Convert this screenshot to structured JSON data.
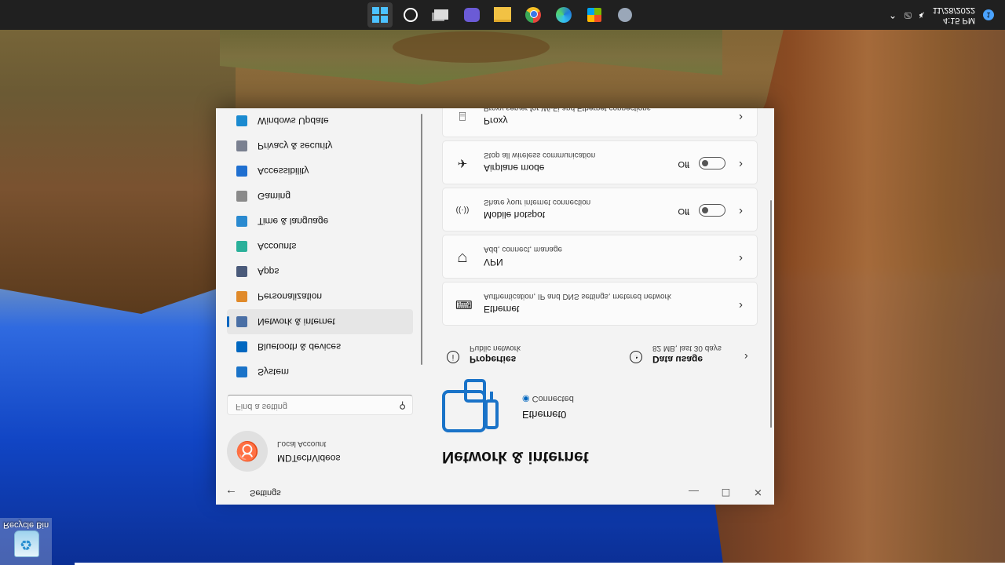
{
  "desktop": {
    "recycle_bin_label": "Recycle Bin"
  },
  "taskbar": {
    "icons": [
      "start-icon",
      "search-icon",
      "task-view-icon",
      "meet-icon",
      "file-explorer-icon",
      "chrome-icon",
      "edge-icon",
      "store-icon",
      "settings-icon"
    ],
    "clock_time": "4:15 PM",
    "clock_date": "11/28/2022",
    "notification_count": "1"
  },
  "window": {
    "title": "Settings",
    "user": {
      "name": "MDTechVideos",
      "account_type": "Local Account"
    },
    "search": {
      "placeholder": "Find a setting"
    },
    "nav": [
      {
        "label": "System",
        "icon": "system-icon",
        "color": "#1a73c8"
      },
      {
        "label": "Bluetooth & devices",
        "icon": "bluetooth-icon",
        "color": "#0067c0"
      },
      {
        "label": "Network & internet",
        "icon": "network-icon",
        "color": "#4a6fa5",
        "selected": true
      },
      {
        "label": "Personalization",
        "icon": "brush-icon",
        "color": "#e08a2a"
      },
      {
        "label": "Apps",
        "icon": "apps-icon",
        "color": "#4a5a7a"
      },
      {
        "label": "Accounts",
        "icon": "accounts-icon",
        "color": "#2ab09a"
      },
      {
        "label": "Time & language",
        "icon": "globe-clock-icon",
        "color": "#2a8ad0"
      },
      {
        "label": "Gaming",
        "icon": "gaming-icon",
        "color": "#8a8a8a"
      },
      {
        "label": "Accessibility",
        "icon": "accessibility-icon",
        "color": "#1f6fd0"
      },
      {
        "label": "Privacy & security",
        "icon": "shield-icon",
        "color": "#7a8090"
      },
      {
        "label": "Windows Update",
        "icon": "update-icon",
        "color": "#1a8ad0"
      }
    ],
    "page": {
      "title": "Network & internet",
      "connection_name": "Ethernet0",
      "connection_status": "Connected",
      "properties": {
        "title": "Properties",
        "subtitle": "Public network"
      },
      "data_usage": {
        "title": "Data usage",
        "subtitle": "82 MB, last 30 days"
      },
      "cards": [
        {
          "title": "Ethernet",
          "subtitle": "Authentication, IP and DNS settings, metered network",
          "icon": "ethernet-icon"
        },
        {
          "title": "VPN",
          "subtitle": "Add, connect, manage",
          "icon": "vpn-icon"
        },
        {
          "title": "Mobile hotspot",
          "subtitle": "Share your internet connection",
          "icon": "hotspot-icon",
          "state": "Off"
        },
        {
          "title": "Airplane mode",
          "subtitle": "Stop all wireless communication",
          "icon": "airplane-icon",
          "state": "Off"
        },
        {
          "title": "Proxy",
          "subtitle": "Proxy server for Wi-Fi and Ethernet connections",
          "icon": "proxy-icon"
        }
      ]
    }
  }
}
